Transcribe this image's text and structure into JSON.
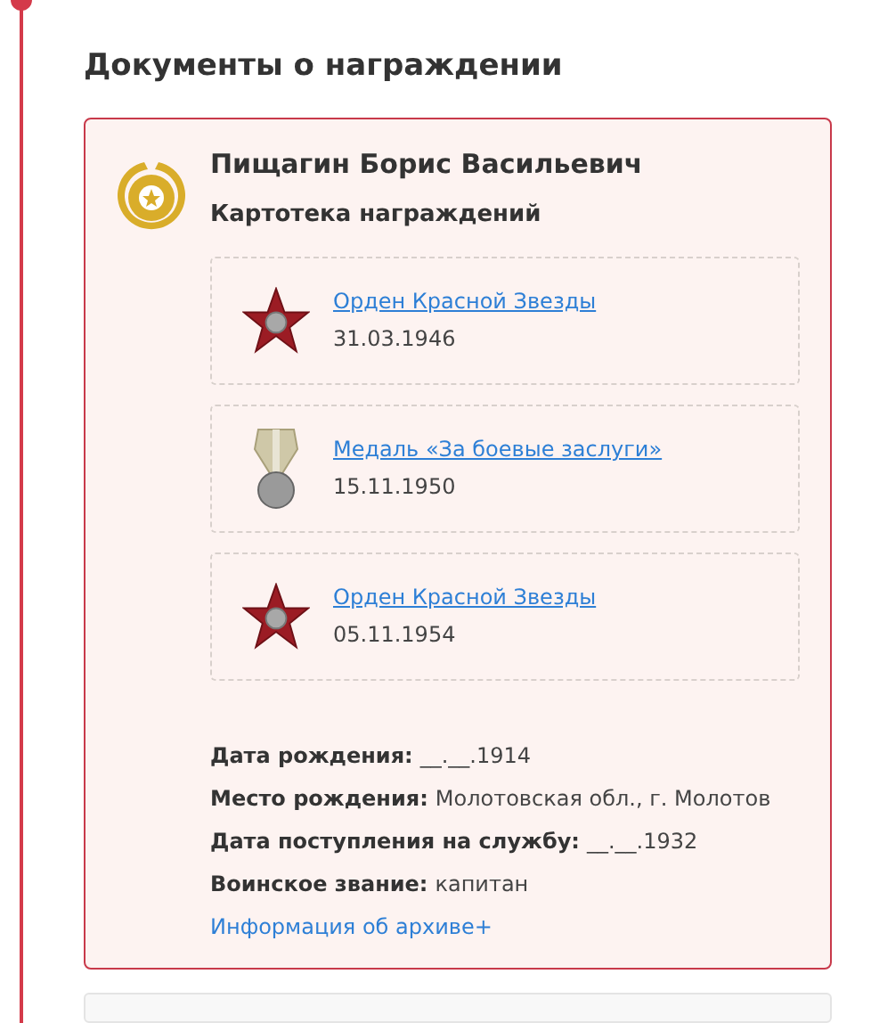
{
  "section_title": "Документы о награждении",
  "card": {
    "name": "Пищагин Борис Васильевич",
    "subtitle": "Картотека награждений",
    "awards": [
      {
        "kind": "star",
        "title": "Орден Красной Звезды",
        "date": "31.03.1946"
      },
      {
        "kind": "medal",
        "title": "Медаль «За боевые заслуги»",
        "date": "15.11.1950"
      },
      {
        "kind": "star",
        "title": "Орден Красной Звезды",
        "date": "05.11.1954"
      }
    ],
    "facts": [
      {
        "label": "Дата рождения:",
        "value": "__.__.1914"
      },
      {
        "label": "Место рождения:",
        "value": "Молотовская обл., г. Молотов"
      },
      {
        "label": "Дата поступления на службу:",
        "value": "__.__.1932"
      },
      {
        "label": "Воинское звание:",
        "value": "капитан"
      }
    ],
    "archive_link": "Информация об архиве+"
  }
}
